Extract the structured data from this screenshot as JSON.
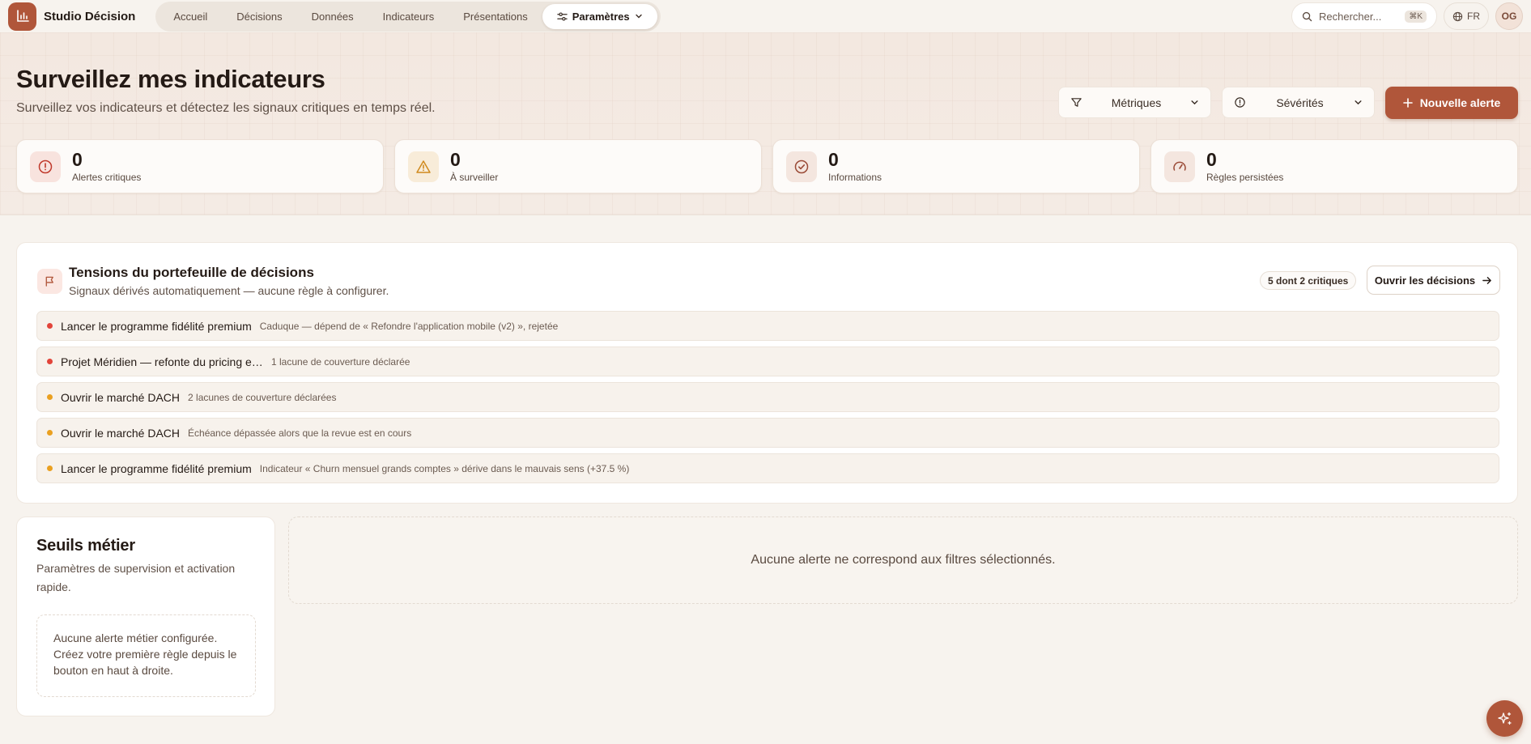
{
  "app": {
    "brand": "Studio Décision",
    "accent": "#b0563a"
  },
  "nav": {
    "items": [
      {
        "label": "Accueil"
      },
      {
        "label": "Décisions"
      },
      {
        "label": "Données"
      },
      {
        "label": "Indicateurs"
      },
      {
        "label": "Présentations"
      }
    ],
    "active": {
      "label": "Paramètres"
    }
  },
  "topright": {
    "search_placeholder": "Rechercher...",
    "search_shortcut": "⌘K",
    "language": "FR",
    "avatar_initials": "OG"
  },
  "hero": {
    "title": "Surveillez mes indicateurs",
    "subtitle": "Surveillez vos indicateurs et détectez les signaux critiques en temps réel.",
    "filters": {
      "metrics": "Métriques",
      "severities": "Sévérités"
    },
    "new_alert": "Nouvelle alerte"
  },
  "stats": [
    {
      "value": "0",
      "label": "Alertes critiques",
      "icon": "alert-circle-icon"
    },
    {
      "value": "0",
      "label": "À surveiller",
      "icon": "warning-triangle-icon"
    },
    {
      "value": "0",
      "label": "Informations",
      "icon": "check-circle-icon"
    },
    {
      "value": "0",
      "label": "Règles persistées",
      "icon": "gauge-icon"
    }
  ],
  "tensions": {
    "title": "Tensions du portefeuille de décisions",
    "subtitle": "Signaux dérivés automatiquement — aucune règle à configurer.",
    "badge": "5 dont 2 critiques",
    "open_button": "Ouvrir les décisions",
    "rows": [
      {
        "severity": "critical",
        "title": "Lancer le programme fidélité premium",
        "desc": "Caduque — dépend de « Refondre l'application mobile (v2) », rejetée"
      },
      {
        "severity": "critical",
        "title": "Projet Méridien — refonte du pricing entreprise",
        "desc": "1 lacune de couverture déclarée"
      },
      {
        "severity": "warning",
        "title": "Ouvrir le marché DACH",
        "desc": "2 lacunes de couverture déclarées"
      },
      {
        "severity": "warning",
        "title": "Ouvrir le marché DACH",
        "desc": "Échéance dépassée alors que la revue est en cours"
      },
      {
        "severity": "warning",
        "title": "Lancer le programme fidélité premium",
        "desc": "Indicateur « Churn mensuel grands comptes » dérive dans le mauvais sens (+37.5 %)"
      }
    ]
  },
  "seuils": {
    "title": "Seuils métier",
    "subtitle": "Paramètres de supervision et activation rapide.",
    "empty": "Aucune alerte métier configurée. Créez votre première règle depuis le bouton en haut à droite."
  },
  "alerts_empty": "Aucune alerte ne correspond aux filtres sélectionnés.",
  "colors": {
    "critical": "#e2443a",
    "warning": "#eaa020"
  }
}
